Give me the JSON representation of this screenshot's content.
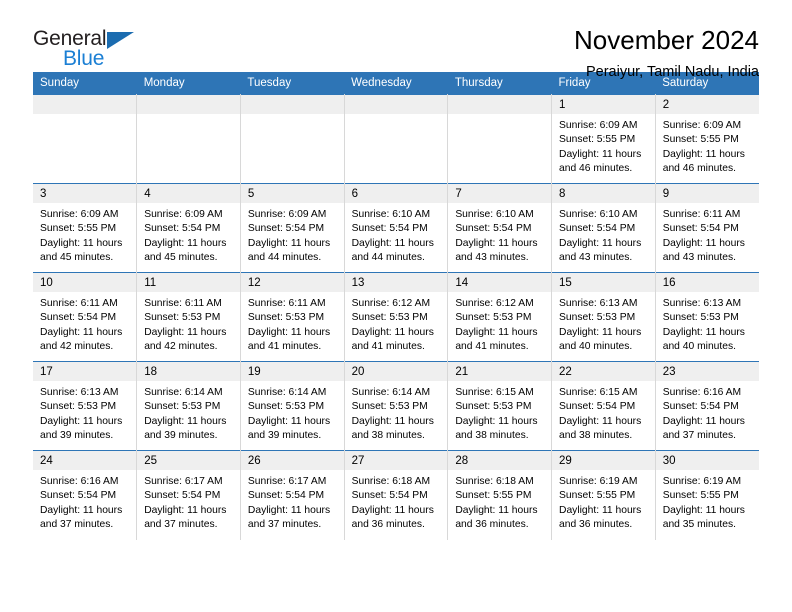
{
  "brand": {
    "name_part1": "General",
    "name_part2": "Blue",
    "logo_icon": "triangle-flag-icon",
    "accent_color": "#1b7fd4",
    "header_color": "#2e75b6"
  },
  "header": {
    "title": "November 2024",
    "subtitle": "Peraiyur, Tamil Nadu, India"
  },
  "calendar": {
    "weekday_headers": [
      "Sunday",
      "Monday",
      "Tuesday",
      "Wednesday",
      "Thursday",
      "Friday",
      "Saturday"
    ],
    "weeks": [
      [
        {
          "day": "",
          "sunrise": "",
          "sunset": "",
          "daylight_line1": "",
          "daylight_line2": ""
        },
        {
          "day": "",
          "sunrise": "",
          "sunset": "",
          "daylight_line1": "",
          "daylight_line2": ""
        },
        {
          "day": "",
          "sunrise": "",
          "sunset": "",
          "daylight_line1": "",
          "daylight_line2": ""
        },
        {
          "day": "",
          "sunrise": "",
          "sunset": "",
          "daylight_line1": "",
          "daylight_line2": ""
        },
        {
          "day": "",
          "sunrise": "",
          "sunset": "",
          "daylight_line1": "",
          "daylight_line2": ""
        },
        {
          "day": "1",
          "sunrise": "Sunrise: 6:09 AM",
          "sunset": "Sunset: 5:55 PM",
          "daylight_line1": "Daylight: 11 hours",
          "daylight_line2": "and 46 minutes."
        },
        {
          "day": "2",
          "sunrise": "Sunrise: 6:09 AM",
          "sunset": "Sunset: 5:55 PM",
          "daylight_line1": "Daylight: 11 hours",
          "daylight_line2": "and 46 minutes."
        }
      ],
      [
        {
          "day": "3",
          "sunrise": "Sunrise: 6:09 AM",
          "sunset": "Sunset: 5:55 PM",
          "daylight_line1": "Daylight: 11 hours",
          "daylight_line2": "and 45 minutes."
        },
        {
          "day": "4",
          "sunrise": "Sunrise: 6:09 AM",
          "sunset": "Sunset: 5:54 PM",
          "daylight_line1": "Daylight: 11 hours",
          "daylight_line2": "and 45 minutes."
        },
        {
          "day": "5",
          "sunrise": "Sunrise: 6:09 AM",
          "sunset": "Sunset: 5:54 PM",
          "daylight_line1": "Daylight: 11 hours",
          "daylight_line2": "and 44 minutes."
        },
        {
          "day": "6",
          "sunrise": "Sunrise: 6:10 AM",
          "sunset": "Sunset: 5:54 PM",
          "daylight_line1": "Daylight: 11 hours",
          "daylight_line2": "and 44 minutes."
        },
        {
          "day": "7",
          "sunrise": "Sunrise: 6:10 AM",
          "sunset": "Sunset: 5:54 PM",
          "daylight_line1": "Daylight: 11 hours",
          "daylight_line2": "and 43 minutes."
        },
        {
          "day": "8",
          "sunrise": "Sunrise: 6:10 AM",
          "sunset": "Sunset: 5:54 PM",
          "daylight_line1": "Daylight: 11 hours",
          "daylight_line2": "and 43 minutes."
        },
        {
          "day": "9",
          "sunrise": "Sunrise: 6:11 AM",
          "sunset": "Sunset: 5:54 PM",
          "daylight_line1": "Daylight: 11 hours",
          "daylight_line2": "and 43 minutes."
        }
      ],
      [
        {
          "day": "10",
          "sunrise": "Sunrise: 6:11 AM",
          "sunset": "Sunset: 5:54 PM",
          "daylight_line1": "Daylight: 11 hours",
          "daylight_line2": "and 42 minutes."
        },
        {
          "day": "11",
          "sunrise": "Sunrise: 6:11 AM",
          "sunset": "Sunset: 5:53 PM",
          "daylight_line1": "Daylight: 11 hours",
          "daylight_line2": "and 42 minutes."
        },
        {
          "day": "12",
          "sunrise": "Sunrise: 6:11 AM",
          "sunset": "Sunset: 5:53 PM",
          "daylight_line1": "Daylight: 11 hours",
          "daylight_line2": "and 41 minutes."
        },
        {
          "day": "13",
          "sunrise": "Sunrise: 6:12 AM",
          "sunset": "Sunset: 5:53 PM",
          "daylight_line1": "Daylight: 11 hours",
          "daylight_line2": "and 41 minutes."
        },
        {
          "day": "14",
          "sunrise": "Sunrise: 6:12 AM",
          "sunset": "Sunset: 5:53 PM",
          "daylight_line1": "Daylight: 11 hours",
          "daylight_line2": "and 41 minutes."
        },
        {
          "day": "15",
          "sunrise": "Sunrise: 6:13 AM",
          "sunset": "Sunset: 5:53 PM",
          "daylight_line1": "Daylight: 11 hours",
          "daylight_line2": "and 40 minutes."
        },
        {
          "day": "16",
          "sunrise": "Sunrise: 6:13 AM",
          "sunset": "Sunset: 5:53 PM",
          "daylight_line1": "Daylight: 11 hours",
          "daylight_line2": "and 40 minutes."
        }
      ],
      [
        {
          "day": "17",
          "sunrise": "Sunrise: 6:13 AM",
          "sunset": "Sunset: 5:53 PM",
          "daylight_line1": "Daylight: 11 hours",
          "daylight_line2": "and 39 minutes."
        },
        {
          "day": "18",
          "sunrise": "Sunrise: 6:14 AM",
          "sunset": "Sunset: 5:53 PM",
          "daylight_line1": "Daylight: 11 hours",
          "daylight_line2": "and 39 minutes."
        },
        {
          "day": "19",
          "sunrise": "Sunrise: 6:14 AM",
          "sunset": "Sunset: 5:53 PM",
          "daylight_line1": "Daylight: 11 hours",
          "daylight_line2": "and 39 minutes."
        },
        {
          "day": "20",
          "sunrise": "Sunrise: 6:14 AM",
          "sunset": "Sunset: 5:53 PM",
          "daylight_line1": "Daylight: 11 hours",
          "daylight_line2": "and 38 minutes."
        },
        {
          "day": "21",
          "sunrise": "Sunrise: 6:15 AM",
          "sunset": "Sunset: 5:53 PM",
          "daylight_line1": "Daylight: 11 hours",
          "daylight_line2": "and 38 minutes."
        },
        {
          "day": "22",
          "sunrise": "Sunrise: 6:15 AM",
          "sunset": "Sunset: 5:54 PM",
          "daylight_line1": "Daylight: 11 hours",
          "daylight_line2": "and 38 minutes."
        },
        {
          "day": "23",
          "sunrise": "Sunrise: 6:16 AM",
          "sunset": "Sunset: 5:54 PM",
          "daylight_line1": "Daylight: 11 hours",
          "daylight_line2": "and 37 minutes."
        }
      ],
      [
        {
          "day": "24",
          "sunrise": "Sunrise: 6:16 AM",
          "sunset": "Sunset: 5:54 PM",
          "daylight_line1": "Daylight: 11 hours",
          "daylight_line2": "and 37 minutes."
        },
        {
          "day": "25",
          "sunrise": "Sunrise: 6:17 AM",
          "sunset": "Sunset: 5:54 PM",
          "daylight_line1": "Daylight: 11 hours",
          "daylight_line2": "and 37 minutes."
        },
        {
          "day": "26",
          "sunrise": "Sunrise: 6:17 AM",
          "sunset": "Sunset: 5:54 PM",
          "daylight_line1": "Daylight: 11 hours",
          "daylight_line2": "and 37 minutes."
        },
        {
          "day": "27",
          "sunrise": "Sunrise: 6:18 AM",
          "sunset": "Sunset: 5:54 PM",
          "daylight_line1": "Daylight: 11 hours",
          "daylight_line2": "and 36 minutes."
        },
        {
          "day": "28",
          "sunrise": "Sunrise: 6:18 AM",
          "sunset": "Sunset: 5:55 PM",
          "daylight_line1": "Daylight: 11 hours",
          "daylight_line2": "and 36 minutes."
        },
        {
          "day": "29",
          "sunrise": "Sunrise: 6:19 AM",
          "sunset": "Sunset: 5:55 PM",
          "daylight_line1": "Daylight: 11 hours",
          "daylight_line2": "and 36 minutes."
        },
        {
          "day": "30",
          "sunrise": "Sunrise: 6:19 AM",
          "sunset": "Sunset: 5:55 PM",
          "daylight_line1": "Daylight: 11 hours",
          "daylight_line2": "and 35 minutes."
        }
      ]
    ]
  }
}
